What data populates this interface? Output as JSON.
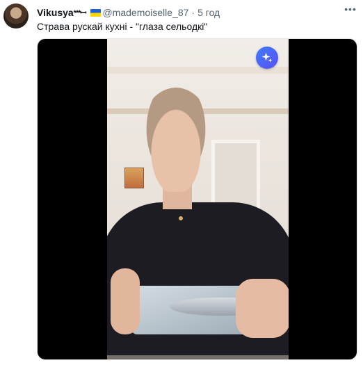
{
  "post": {
    "display_name": "Vikusya",
    "name_suffix": "***ꟷ̶",
    "handle": "@mademoiselle_87",
    "separator": "·",
    "time": "5 год",
    "text": "Страва рускай кухні - \"глаза сельодкі\"",
    "more_icon": "more-horizontal-icon"
  },
  "media": {
    "type": "video",
    "badge_icon": "sparkle-icon",
    "badge_color": "#4a66f8"
  },
  "colors": {
    "name": "#0f1419",
    "secondary": "#536471",
    "flag_blue": "#1f5fd1",
    "flag_yellow": "#ffd500"
  }
}
